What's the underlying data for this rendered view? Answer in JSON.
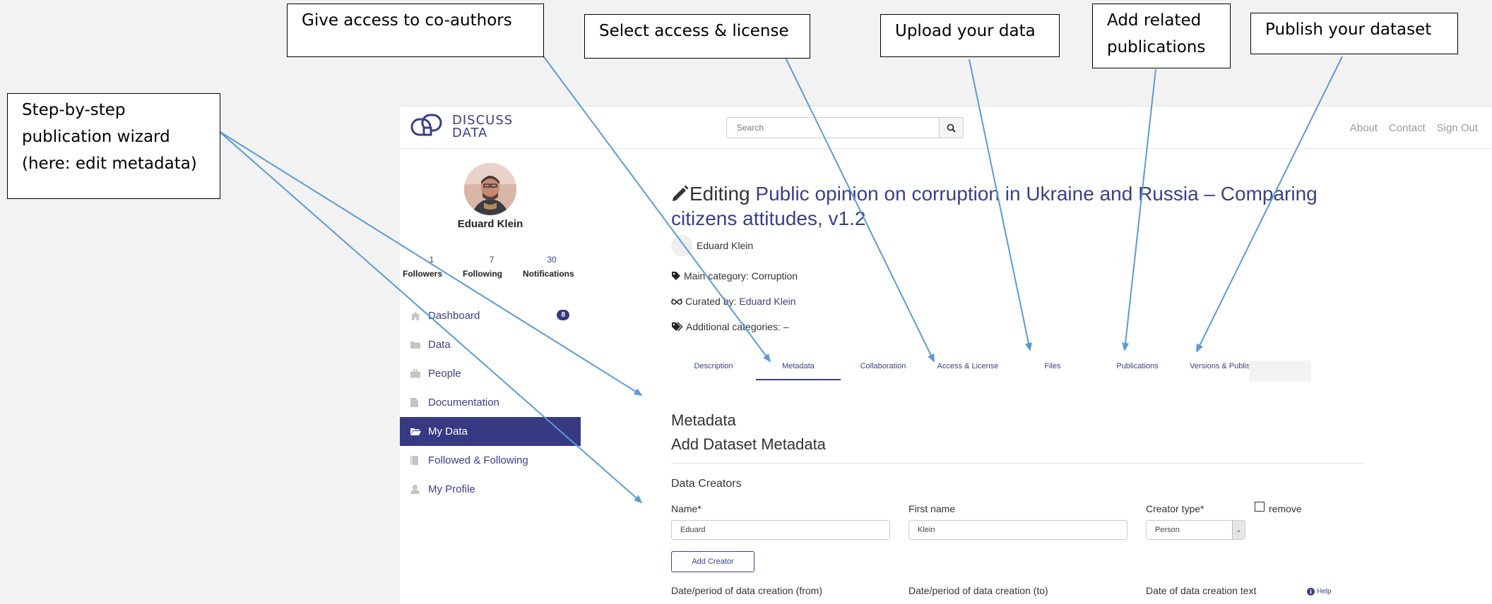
{
  "callouts": {
    "wizard": [
      "Step-by-step",
      "publication wizard",
      "(here: edit metadata)"
    ],
    "coauthors": "Give access to co-authors",
    "license": "Select access & license",
    "upload": "Upload your data",
    "publications": [
      "Add related",
      "publications"
    ],
    "publish": "Publish your dataset"
  },
  "header": {
    "logo_line1": "DISCUSS",
    "logo_line2": "DATA",
    "search_placeholder": "Search",
    "links": [
      "About",
      "Contact",
      "Sign Out"
    ]
  },
  "sidebar": {
    "name": "Eduard Klein",
    "stats": [
      {
        "value": "1",
        "label": "Followers"
      },
      {
        "value": "7",
        "label": "Following"
      },
      {
        "value": "30",
        "label": "Notifications"
      }
    ],
    "items": [
      {
        "label": "Dashboard",
        "icon": "home-icon",
        "badge": "8"
      },
      {
        "label": "Data",
        "icon": "folder-icon"
      },
      {
        "label": "People",
        "icon": "briefcase-icon"
      },
      {
        "label": "Documentation",
        "icon": "file-icon"
      },
      {
        "label": "My Data",
        "icon": "folder-open-icon",
        "active": true
      },
      {
        "label": "Followed & Following",
        "icon": "book-icon"
      },
      {
        "label": "My Profile",
        "icon": "user-icon"
      }
    ]
  },
  "main": {
    "editing_label": "Editing",
    "dataset_title": "Public opinion on corruption in Ukraine and Russia – Comparing citizens attitudes, v1.2",
    "author": "Eduard Klein",
    "main_category": "Main category: Corruption",
    "curated_prefix": "Curated by:",
    "curated_by": "Eduard Klein",
    "additional_categories": "Additional categories: –",
    "tabs": [
      "Description",
      "Metadata",
      "Collaboration",
      "Access & License",
      "Files",
      "Publications",
      "Versions & Publish"
    ],
    "active_tab": "Metadata",
    "section_heading": "Metadata",
    "subheading": "Add Dataset Metadata",
    "creators_title": "Data Creators",
    "name_label": "Name*",
    "name_value": "Eduard",
    "first_name_label": "First name",
    "first_name_value": "Klein",
    "creator_type_label": "Creator type*",
    "creator_type_value": "Person",
    "remove_label": "remove",
    "add_creator_label": "Add Creator",
    "date_from_label": "Date/period of data creation (from)",
    "date_to_label": "Date/period of data creation (to)",
    "date_text_label": "Date of data creation text",
    "help_label": "Help"
  },
  "colors": {
    "accent": "#3a3f8a",
    "active_nav": "#373a82",
    "arrow": "#5b9bd5"
  }
}
